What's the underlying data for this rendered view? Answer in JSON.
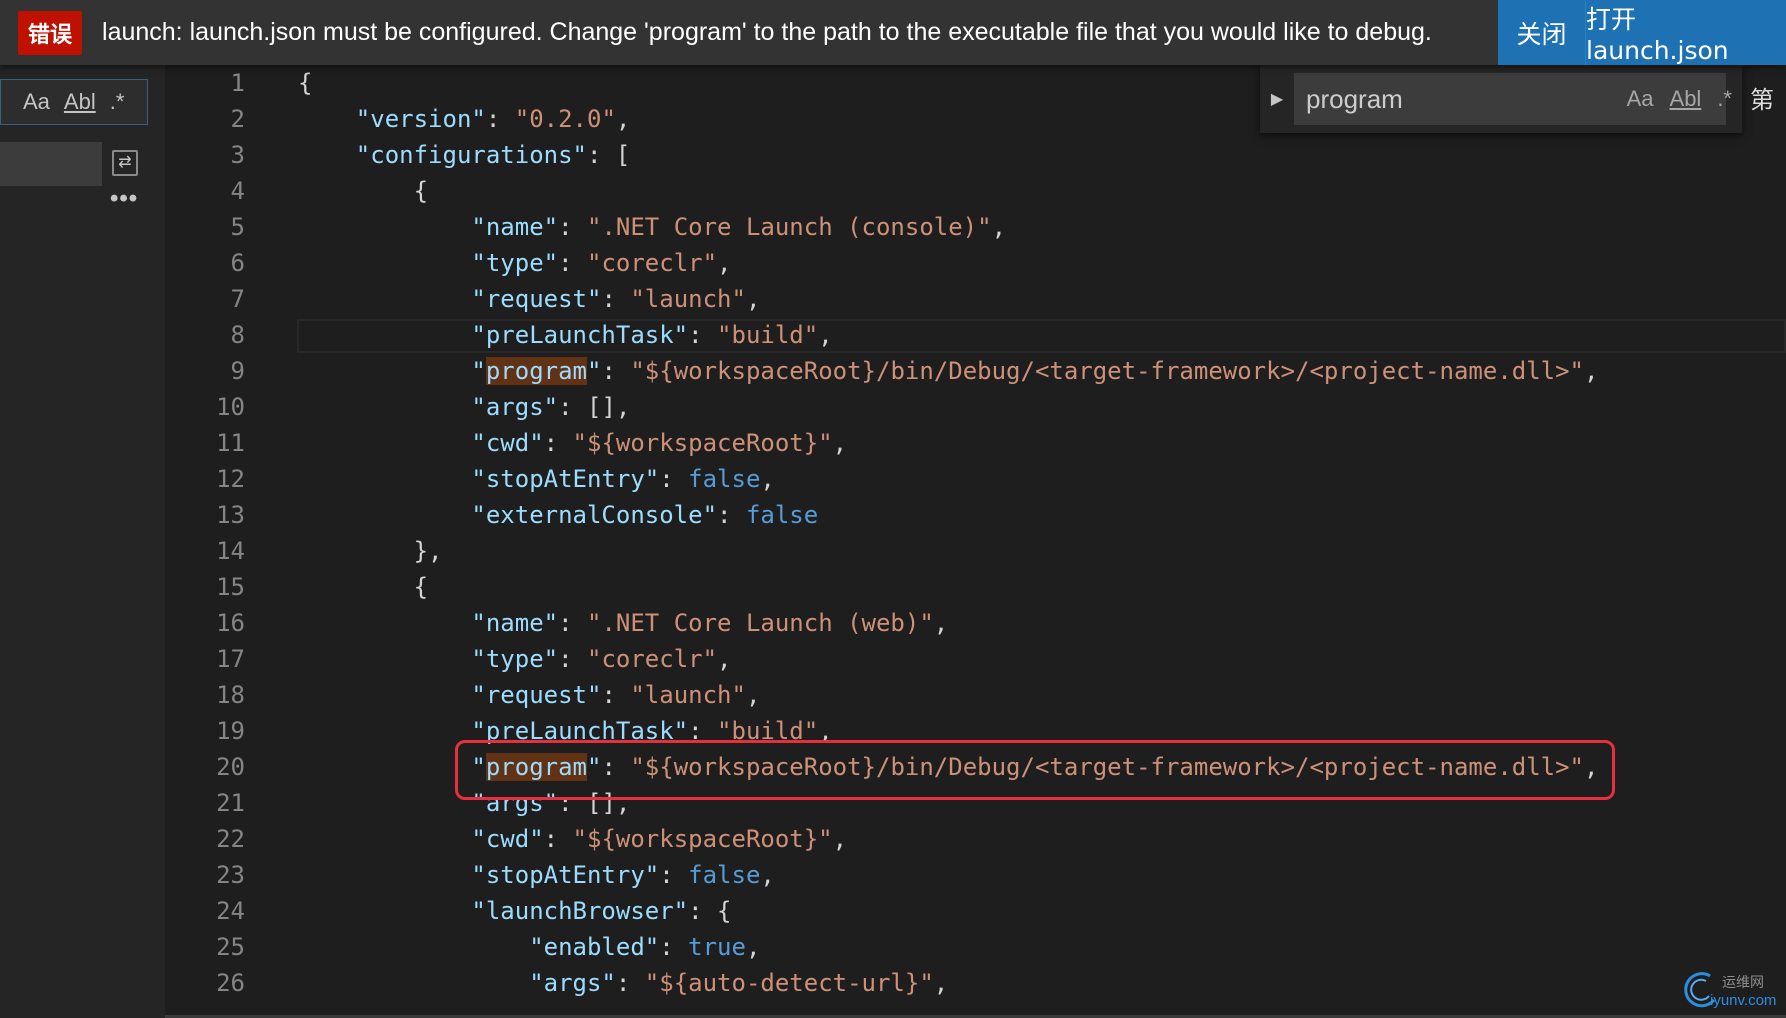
{
  "notification": {
    "badge": "错误",
    "message": "launch: launch.json must be configured. Change 'program' to the path to the executable file that you would like to debug.",
    "close_label": "关闭",
    "open_label": "打开 launch.json"
  },
  "search_panel": {
    "match_case": "Aa",
    "whole_word": "Abl",
    "regex": ".*",
    "more": "•••"
  },
  "find_widget": {
    "query": "program",
    "match_case": "Aa",
    "whole_word": "Abl",
    "regex": ".*",
    "count_prefix": "第"
  },
  "editor": {
    "lines": [
      {
        "n": "1",
        "indent": 0,
        "tokens": [
          {
            "t": "p",
            "v": "{"
          }
        ]
      },
      {
        "n": "2",
        "indent": 1,
        "tokens": [
          {
            "t": "k",
            "v": "\"version\""
          },
          {
            "t": "p",
            "v": ": "
          },
          {
            "t": "s",
            "v": "\"0.2.0\""
          },
          {
            "t": "p",
            "v": ","
          }
        ]
      },
      {
        "n": "3",
        "indent": 1,
        "tokens": [
          {
            "t": "k",
            "v": "\"configurations\""
          },
          {
            "t": "p",
            "v": ": ["
          }
        ]
      },
      {
        "n": "4",
        "indent": 2,
        "tokens": [
          {
            "t": "p",
            "v": "{"
          }
        ]
      },
      {
        "n": "5",
        "indent": 3,
        "tokens": [
          {
            "t": "k",
            "v": "\"name\""
          },
          {
            "t": "p",
            "v": ": "
          },
          {
            "t": "s",
            "v": "\".NET Core Launch (console)\""
          },
          {
            "t": "p",
            "v": ","
          }
        ]
      },
      {
        "n": "6",
        "indent": 3,
        "tokens": [
          {
            "t": "k",
            "v": "\"type\""
          },
          {
            "t": "p",
            "v": ": "
          },
          {
            "t": "s",
            "v": "\"coreclr\""
          },
          {
            "t": "p",
            "v": ","
          }
        ]
      },
      {
        "n": "7",
        "indent": 3,
        "tokens": [
          {
            "t": "k",
            "v": "\"request\""
          },
          {
            "t": "p",
            "v": ": "
          },
          {
            "t": "s",
            "v": "\"launch\""
          },
          {
            "t": "p",
            "v": ","
          }
        ]
      },
      {
        "n": "8",
        "indent": 3,
        "tokens": [
          {
            "t": "k",
            "v": "\"preLaunchTask\""
          },
          {
            "t": "p",
            "v": ": "
          },
          {
            "t": "s",
            "v": "\"build\""
          },
          {
            "t": "p",
            "v": ","
          }
        ]
      },
      {
        "n": "9",
        "indent": 3,
        "tokens": [
          {
            "t": "k",
            "v": "\""
          },
          {
            "t": "kh",
            "v": "program"
          },
          {
            "t": "k",
            "v": "\""
          },
          {
            "t": "p",
            "v": ": "
          },
          {
            "t": "s",
            "v": "\"${workspaceRoot}/bin/Debug/<target-framework>/<project-name.dll>\""
          },
          {
            "t": "p",
            "v": ","
          }
        ]
      },
      {
        "n": "10",
        "indent": 3,
        "tokens": [
          {
            "t": "k",
            "v": "\"args\""
          },
          {
            "t": "p",
            "v": ": [],"
          }
        ]
      },
      {
        "n": "11",
        "indent": 3,
        "tokens": [
          {
            "t": "k",
            "v": "\"cwd\""
          },
          {
            "t": "p",
            "v": ": "
          },
          {
            "t": "s",
            "v": "\"${workspaceRoot}\""
          },
          {
            "t": "p",
            "v": ","
          }
        ]
      },
      {
        "n": "12",
        "indent": 3,
        "tokens": [
          {
            "t": "k",
            "v": "\"stopAtEntry\""
          },
          {
            "t": "p",
            "v": ": "
          },
          {
            "t": "b",
            "v": "false"
          },
          {
            "t": "p",
            "v": ","
          }
        ]
      },
      {
        "n": "13",
        "indent": 3,
        "tokens": [
          {
            "t": "k",
            "v": "\"externalConsole\""
          },
          {
            "t": "p",
            "v": ": "
          },
          {
            "t": "b",
            "v": "false"
          }
        ]
      },
      {
        "n": "14",
        "indent": 2,
        "tokens": [
          {
            "t": "p",
            "v": "},"
          }
        ]
      },
      {
        "n": "15",
        "indent": 2,
        "tokens": [
          {
            "t": "p",
            "v": "{"
          }
        ]
      },
      {
        "n": "16",
        "indent": 3,
        "tokens": [
          {
            "t": "k",
            "v": "\"name\""
          },
          {
            "t": "p",
            "v": ": "
          },
          {
            "t": "s",
            "v": "\".NET Core Launch (web)\""
          },
          {
            "t": "p",
            "v": ","
          }
        ]
      },
      {
        "n": "17",
        "indent": 3,
        "tokens": [
          {
            "t": "k",
            "v": "\"type\""
          },
          {
            "t": "p",
            "v": ": "
          },
          {
            "t": "s",
            "v": "\"coreclr\""
          },
          {
            "t": "p",
            "v": ","
          }
        ]
      },
      {
        "n": "18",
        "indent": 3,
        "tokens": [
          {
            "t": "k",
            "v": "\"request\""
          },
          {
            "t": "p",
            "v": ": "
          },
          {
            "t": "s",
            "v": "\"launch\""
          },
          {
            "t": "p",
            "v": ","
          }
        ]
      },
      {
        "n": "19",
        "indent": 3,
        "tokens": [
          {
            "t": "k",
            "v": "\"preLaunchTask\""
          },
          {
            "t": "p",
            "v": ": "
          },
          {
            "t": "s",
            "v": "\"build\""
          },
          {
            "t": "p",
            "v": ","
          }
        ]
      },
      {
        "n": "20",
        "indent": 3,
        "tokens": [
          {
            "t": "k",
            "v": "\""
          },
          {
            "t": "kh",
            "v": "program"
          },
          {
            "t": "k",
            "v": "\""
          },
          {
            "t": "p",
            "v": ": "
          },
          {
            "t": "s",
            "v": "\"${workspaceRoot}/bin/Debug/<target-framework>/<project-name.dll>\""
          },
          {
            "t": "p",
            "v": ","
          }
        ]
      },
      {
        "n": "21",
        "indent": 3,
        "tokens": [
          {
            "t": "k",
            "v": "\"args\""
          },
          {
            "t": "p",
            "v": ": [],"
          }
        ]
      },
      {
        "n": "22",
        "indent": 3,
        "tokens": [
          {
            "t": "k",
            "v": "\"cwd\""
          },
          {
            "t": "p",
            "v": ": "
          },
          {
            "t": "s",
            "v": "\"${workspaceRoot}\""
          },
          {
            "t": "p",
            "v": ","
          }
        ]
      },
      {
        "n": "23",
        "indent": 3,
        "tokens": [
          {
            "t": "k",
            "v": "\"stopAtEntry\""
          },
          {
            "t": "p",
            "v": ": "
          },
          {
            "t": "b",
            "v": "false"
          },
          {
            "t": "p",
            "v": ","
          }
        ]
      },
      {
        "n": "24",
        "indent": 3,
        "tokens": [
          {
            "t": "k",
            "v": "\"launchBrowser\""
          },
          {
            "t": "p",
            "v": ": {"
          }
        ]
      },
      {
        "n": "25",
        "indent": 4,
        "tokens": [
          {
            "t": "k",
            "v": "\"enabled\""
          },
          {
            "t": "p",
            "v": ": "
          },
          {
            "t": "b",
            "v": "true"
          },
          {
            "t": "p",
            "v": ","
          }
        ]
      },
      {
        "n": "26",
        "indent": 4,
        "tokens": [
          {
            "t": "k",
            "v": "\"args\""
          },
          {
            "t": "p",
            "v": ": "
          },
          {
            "t": "s",
            "v": "\"${auto-detect-url}\""
          },
          {
            "t": "p",
            "v": ","
          }
        ]
      }
    ]
  },
  "watermark": {
    "cn": "运维网",
    "en": "iyunv.com"
  }
}
